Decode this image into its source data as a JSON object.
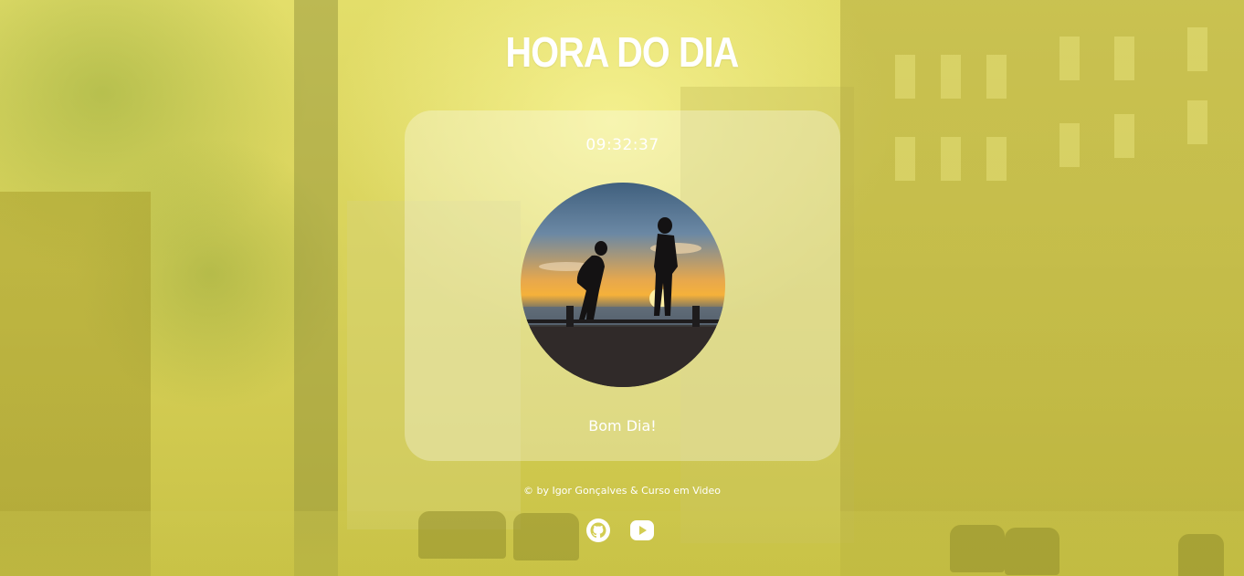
{
  "page": {
    "title": "HORA DO DIA"
  },
  "clock": {
    "time": "09:32:37",
    "greeting": "Bom Dia!",
    "image_subject": "two silhouetted people on a pier at sunset"
  },
  "footer": {
    "credit": "© by Igor Gonçalves & Curso em Video",
    "links": [
      {
        "icon": "github-icon"
      },
      {
        "icon": "youtube-icon"
      }
    ]
  },
  "colors": {
    "background_accent": "#d8d25a",
    "text": "#ffffff",
    "card": "rgba(255,255,255,0.30)"
  }
}
